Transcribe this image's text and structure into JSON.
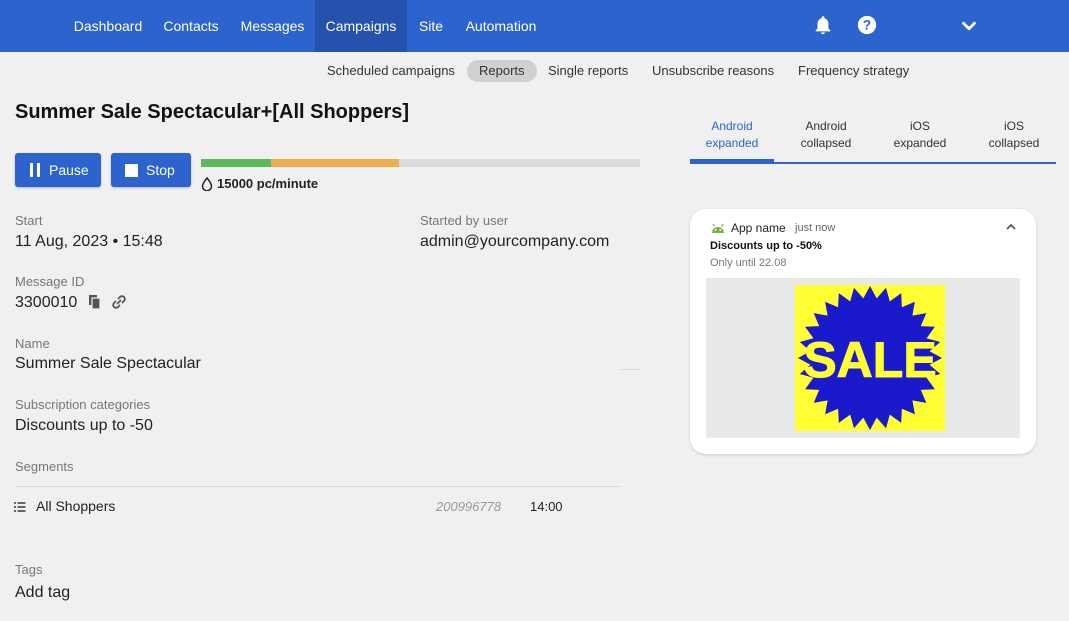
{
  "nav": {
    "items": [
      {
        "label": "Dashboard"
      },
      {
        "label": "Contacts"
      },
      {
        "label": "Messages"
      },
      {
        "label": "Campaigns"
      },
      {
        "label": "Site"
      },
      {
        "label": "Automation"
      }
    ],
    "active": "Campaigns"
  },
  "subnav": {
    "items": [
      {
        "label": "Scheduled campaigns"
      },
      {
        "label": "Reports"
      },
      {
        "label": "Single reports"
      },
      {
        "label": "Unsubscribe reasons"
      },
      {
        "label": "Frequency strategy"
      }
    ],
    "active": "Reports"
  },
  "page": {
    "title": "Summer Sale Spectacular+[All Shoppers]"
  },
  "controls": {
    "pause_label": "Pause",
    "stop_label": "Stop",
    "rate_label": "15000 pc/minute",
    "progress": {
      "green_fraction": 0.16,
      "orange_fraction": 0.29
    }
  },
  "colors": {
    "primary": "#2d63cd",
    "progress_green": "#5cb85c",
    "progress_orange": "#f0ad4e",
    "sale_yellow": "#ffff33",
    "sale_blue": "#1a1acc"
  },
  "details": {
    "start_label": "Start",
    "start_value": "11 Aug, 2023 • 15:48",
    "started_by_label": "Started by user",
    "started_by_value": "admin@yourcompany.com",
    "message_id_label": "Message ID",
    "message_id_value": "3300010",
    "name_label": "Name",
    "name_value": "Summer Sale Spectacular",
    "subscription_label": "Subscription categories",
    "subscription_value": "Discounts up to -50",
    "segments_label": "Segments",
    "tags_label": "Tags",
    "tags_value": "Add tag"
  },
  "segments": [
    {
      "name": "All Shoppers",
      "count": "200996778",
      "time": "14:00"
    }
  ],
  "preview": {
    "tabs": [
      {
        "line1": "Android",
        "line2": "expanded"
      },
      {
        "line1": "Android",
        "line2": "collapsed"
      },
      {
        "line1": "iOS",
        "line2": "expanded"
      },
      {
        "line1": "iOS",
        "line2": "collapsed"
      }
    ],
    "active_tab": 0,
    "notification": {
      "app_name": "App name",
      "time": "just now",
      "title": "Discounts up to -50%",
      "body": "Only until 22.08",
      "image_text": "SALE"
    }
  },
  "icons": {
    "bell": "bell-icon",
    "help": "help-icon",
    "dropdown": "chevron-down-icon",
    "pause": "pause-icon",
    "stop": "stop-icon",
    "drop": "drop-icon",
    "copy": "copy-icon",
    "link": "link-icon",
    "list": "list-icon",
    "android": "android-icon",
    "collapse": "chevron-up-icon"
  }
}
